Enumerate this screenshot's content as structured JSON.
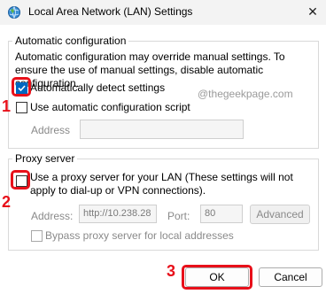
{
  "window": {
    "title": "Local Area Network (LAN) Settings",
    "close_glyph": "✕"
  },
  "auto_config": {
    "group_title": "Automatic configuration",
    "description": "Automatic configuration may override manual settings.  To ensure the use of manual settings, disable automatic configuration.",
    "detect_label": "Automatically detect settings",
    "detect_checked": true,
    "script_label": "Use automatic configuration script",
    "script_checked": false,
    "address_label": "Address",
    "address_value": ""
  },
  "proxy": {
    "group_title": "Proxy server",
    "use_proxy_label": "Use a proxy server for your LAN (These settings will not apply to dial-up or VPN connections).",
    "use_proxy_checked": false,
    "address_label": "Address:",
    "address_value": "http://10.238.28",
    "port_label": "Port:",
    "port_value": "80",
    "advanced_label": "Advanced",
    "bypass_label": "Bypass proxy server for local addresses",
    "bypass_checked": false
  },
  "footer": {
    "ok_label": "OK",
    "cancel_label": "Cancel"
  },
  "annotations": {
    "step1": "1",
    "step2": "2",
    "step3": "3",
    "watermark": "@thegeekpage.com",
    "highlight_color": "#e8101a"
  },
  "colors": {
    "accent": "#0067c0"
  }
}
